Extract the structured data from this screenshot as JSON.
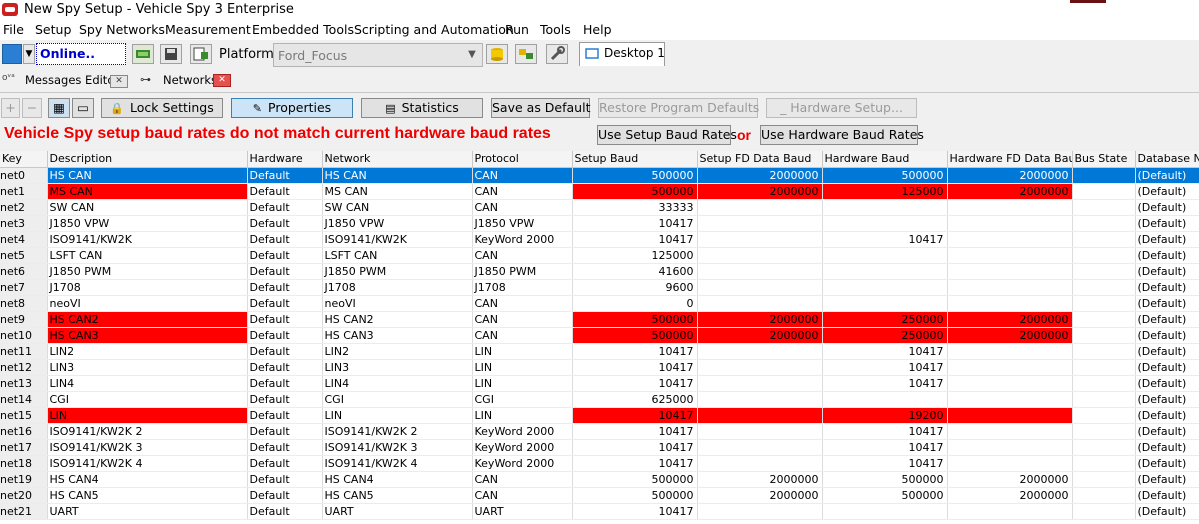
{
  "window": {
    "title": "New Spy Setup - Vehicle Spy 3 Enterprise"
  },
  "menu": [
    "File",
    "Setup",
    "Spy Networks",
    "Measurement",
    "Embedded Tools",
    "Scripting and Automation",
    "Run",
    "Tools",
    "Help"
  ],
  "toolbar": {
    "online_label": "Online..",
    "platform_label": "Platform:",
    "platform_value": "Ford_Focus",
    "desktop_tab": "Desktop 1"
  },
  "subtabs": {
    "messages_editor": "Messages Editor",
    "networks": "Networks"
  },
  "buttons": {
    "lock_settings": "Lock Settings",
    "properties": "Properties",
    "statistics": "Statistics",
    "save_as_default": "Save as Default",
    "restore_program_defaults": "Restore Program Defaults",
    "hardware_setup": "_ Hardware Setup..."
  },
  "warning": {
    "message": "Vehicle Spy setup baud rates do not match current hardware baud rates",
    "use_setup": "Use Setup Baud Rates",
    "or": "or",
    "use_hardware": "Use Hardware Baud Rates"
  },
  "colors": {
    "mismatch": "#ff0000",
    "selection": "#0078d7",
    "warning_text": "#ee0000"
  },
  "table": {
    "columns": [
      "Key",
      "Description",
      "Hardware",
      "Network",
      "Protocol",
      "Setup Baud",
      "Setup FD Data Baud",
      "Hardware Baud",
      "Hardware FD Data Baud",
      "Bus State",
      "Database Ne"
    ],
    "rows": [
      {
        "key": "net0",
        "desc": "HS CAN",
        "hw": "Default",
        "net": "HS CAN",
        "proto": "CAN",
        "sb": "500000",
        "sfd": "2000000",
        "hb": "500000",
        "hfd": "2000000",
        "db": "(Default)",
        "selected": true,
        "mismatch": false
      },
      {
        "key": "net1",
        "desc": "MS CAN",
        "hw": "Default",
        "net": "MS CAN",
        "proto": "CAN",
        "sb": "500000",
        "sfd": "2000000",
        "hb": "125000",
        "hfd": "2000000",
        "db": "(Default)",
        "mismatch": true
      },
      {
        "key": "net2",
        "desc": "SW CAN",
        "hw": "Default",
        "net": "SW CAN",
        "proto": "CAN",
        "sb": "33333",
        "sfd": "",
        "hb": "",
        "hfd": "",
        "db": "(Default)"
      },
      {
        "key": "net3",
        "desc": "J1850 VPW",
        "hw": "Default",
        "net": "J1850 VPW",
        "proto": "J1850 VPW",
        "sb": "10417",
        "sfd": "",
        "hb": "",
        "hfd": "",
        "db": "(Default)"
      },
      {
        "key": "net4",
        "desc": "ISO9141/KW2K",
        "hw": "Default",
        "net": "ISO9141/KW2K",
        "proto": "KeyWord 2000",
        "sb": "10417",
        "sfd": "",
        "hb": "10417",
        "hfd": "",
        "db": "(Default)"
      },
      {
        "key": "net5",
        "desc": "LSFT CAN",
        "hw": "Default",
        "net": "LSFT CAN",
        "proto": "CAN",
        "sb": "125000",
        "sfd": "",
        "hb": "",
        "hfd": "",
        "db": "(Default)"
      },
      {
        "key": "net6",
        "desc": "J1850 PWM",
        "hw": "Default",
        "net": "J1850 PWM",
        "proto": "J1850 PWM",
        "sb": "41600",
        "sfd": "",
        "hb": "",
        "hfd": "",
        "db": "(Default)"
      },
      {
        "key": "net7",
        "desc": "J1708",
        "hw": "Default",
        "net": "J1708",
        "proto": "J1708",
        "sb": "9600",
        "sfd": "",
        "hb": "",
        "hfd": "",
        "db": "(Default)"
      },
      {
        "key": "net8",
        "desc": "neoVI",
        "hw": "Default",
        "net": "neoVI",
        "proto": "CAN",
        "sb": "0",
        "sfd": "",
        "hb": "",
        "hfd": "",
        "db": "(Default)"
      },
      {
        "key": "net9",
        "desc": "HS CAN2",
        "hw": "Default",
        "net": "HS CAN2",
        "proto": "CAN",
        "sb": "500000",
        "sfd": "2000000",
        "hb": "250000",
        "hfd": "2000000",
        "db": "(Default)",
        "mismatch": true
      },
      {
        "key": "net10",
        "desc": "HS CAN3",
        "hw": "Default",
        "net": "HS CAN3",
        "proto": "CAN",
        "sb": "500000",
        "sfd": "2000000",
        "hb": "250000",
        "hfd": "2000000",
        "db": "(Default)",
        "mismatch": true
      },
      {
        "key": "net11",
        "desc": "LIN2",
        "hw": "Default",
        "net": "LIN2",
        "proto": "LIN",
        "sb": "10417",
        "sfd": "",
        "hb": "10417",
        "hfd": "",
        "db": "(Default)"
      },
      {
        "key": "net12",
        "desc": "LIN3",
        "hw": "Default",
        "net": "LIN3",
        "proto": "LIN",
        "sb": "10417",
        "sfd": "",
        "hb": "10417",
        "hfd": "",
        "db": "(Default)"
      },
      {
        "key": "net13",
        "desc": "LIN4",
        "hw": "Default",
        "net": "LIN4",
        "proto": "LIN",
        "sb": "10417",
        "sfd": "",
        "hb": "10417",
        "hfd": "",
        "db": "(Default)"
      },
      {
        "key": "net14",
        "desc": "CGI",
        "hw": "Default",
        "net": "CGI",
        "proto": "CGI",
        "sb": "625000",
        "sfd": "",
        "hb": "",
        "hfd": "",
        "db": "(Default)"
      },
      {
        "key": "net15",
        "desc": "LIN",
        "hw": "Default",
        "net": "LIN",
        "proto": "LIN",
        "sb": "10417",
        "sfd": "",
        "hb": "19200",
        "hfd": "",
        "db": "(Default)",
        "mismatch": true
      },
      {
        "key": "net16",
        "desc": "ISO9141/KW2K 2",
        "hw": "Default",
        "net": "ISO9141/KW2K 2",
        "proto": "KeyWord 2000",
        "sb": "10417",
        "sfd": "",
        "hb": "10417",
        "hfd": "",
        "db": "(Default)"
      },
      {
        "key": "net17",
        "desc": "ISO9141/KW2K 3",
        "hw": "Default",
        "net": "ISO9141/KW2K 3",
        "proto": "KeyWord 2000",
        "sb": "10417",
        "sfd": "",
        "hb": "10417",
        "hfd": "",
        "db": "(Default)"
      },
      {
        "key": "net18",
        "desc": "ISO9141/KW2K 4",
        "hw": "Default",
        "net": "ISO9141/KW2K 4",
        "proto": "KeyWord 2000",
        "sb": "10417",
        "sfd": "",
        "hb": "10417",
        "hfd": "",
        "db": "(Default)"
      },
      {
        "key": "net19",
        "desc": "HS CAN4",
        "hw": "Default",
        "net": "HS CAN4",
        "proto": "CAN",
        "sb": "500000",
        "sfd": "2000000",
        "hb": "500000",
        "hfd": "2000000",
        "db": "(Default)"
      },
      {
        "key": "net20",
        "desc": "HS CAN5",
        "hw": "Default",
        "net": "HS CAN5",
        "proto": "CAN",
        "sb": "500000",
        "sfd": "2000000",
        "hb": "500000",
        "hfd": "2000000",
        "db": "(Default)"
      },
      {
        "key": "net21",
        "desc": "UART",
        "hw": "Default",
        "net": "UART",
        "proto": "UART",
        "sb": "10417",
        "sfd": "",
        "hb": "",
        "hfd": "",
        "db": "(Default)"
      }
    ]
  }
}
